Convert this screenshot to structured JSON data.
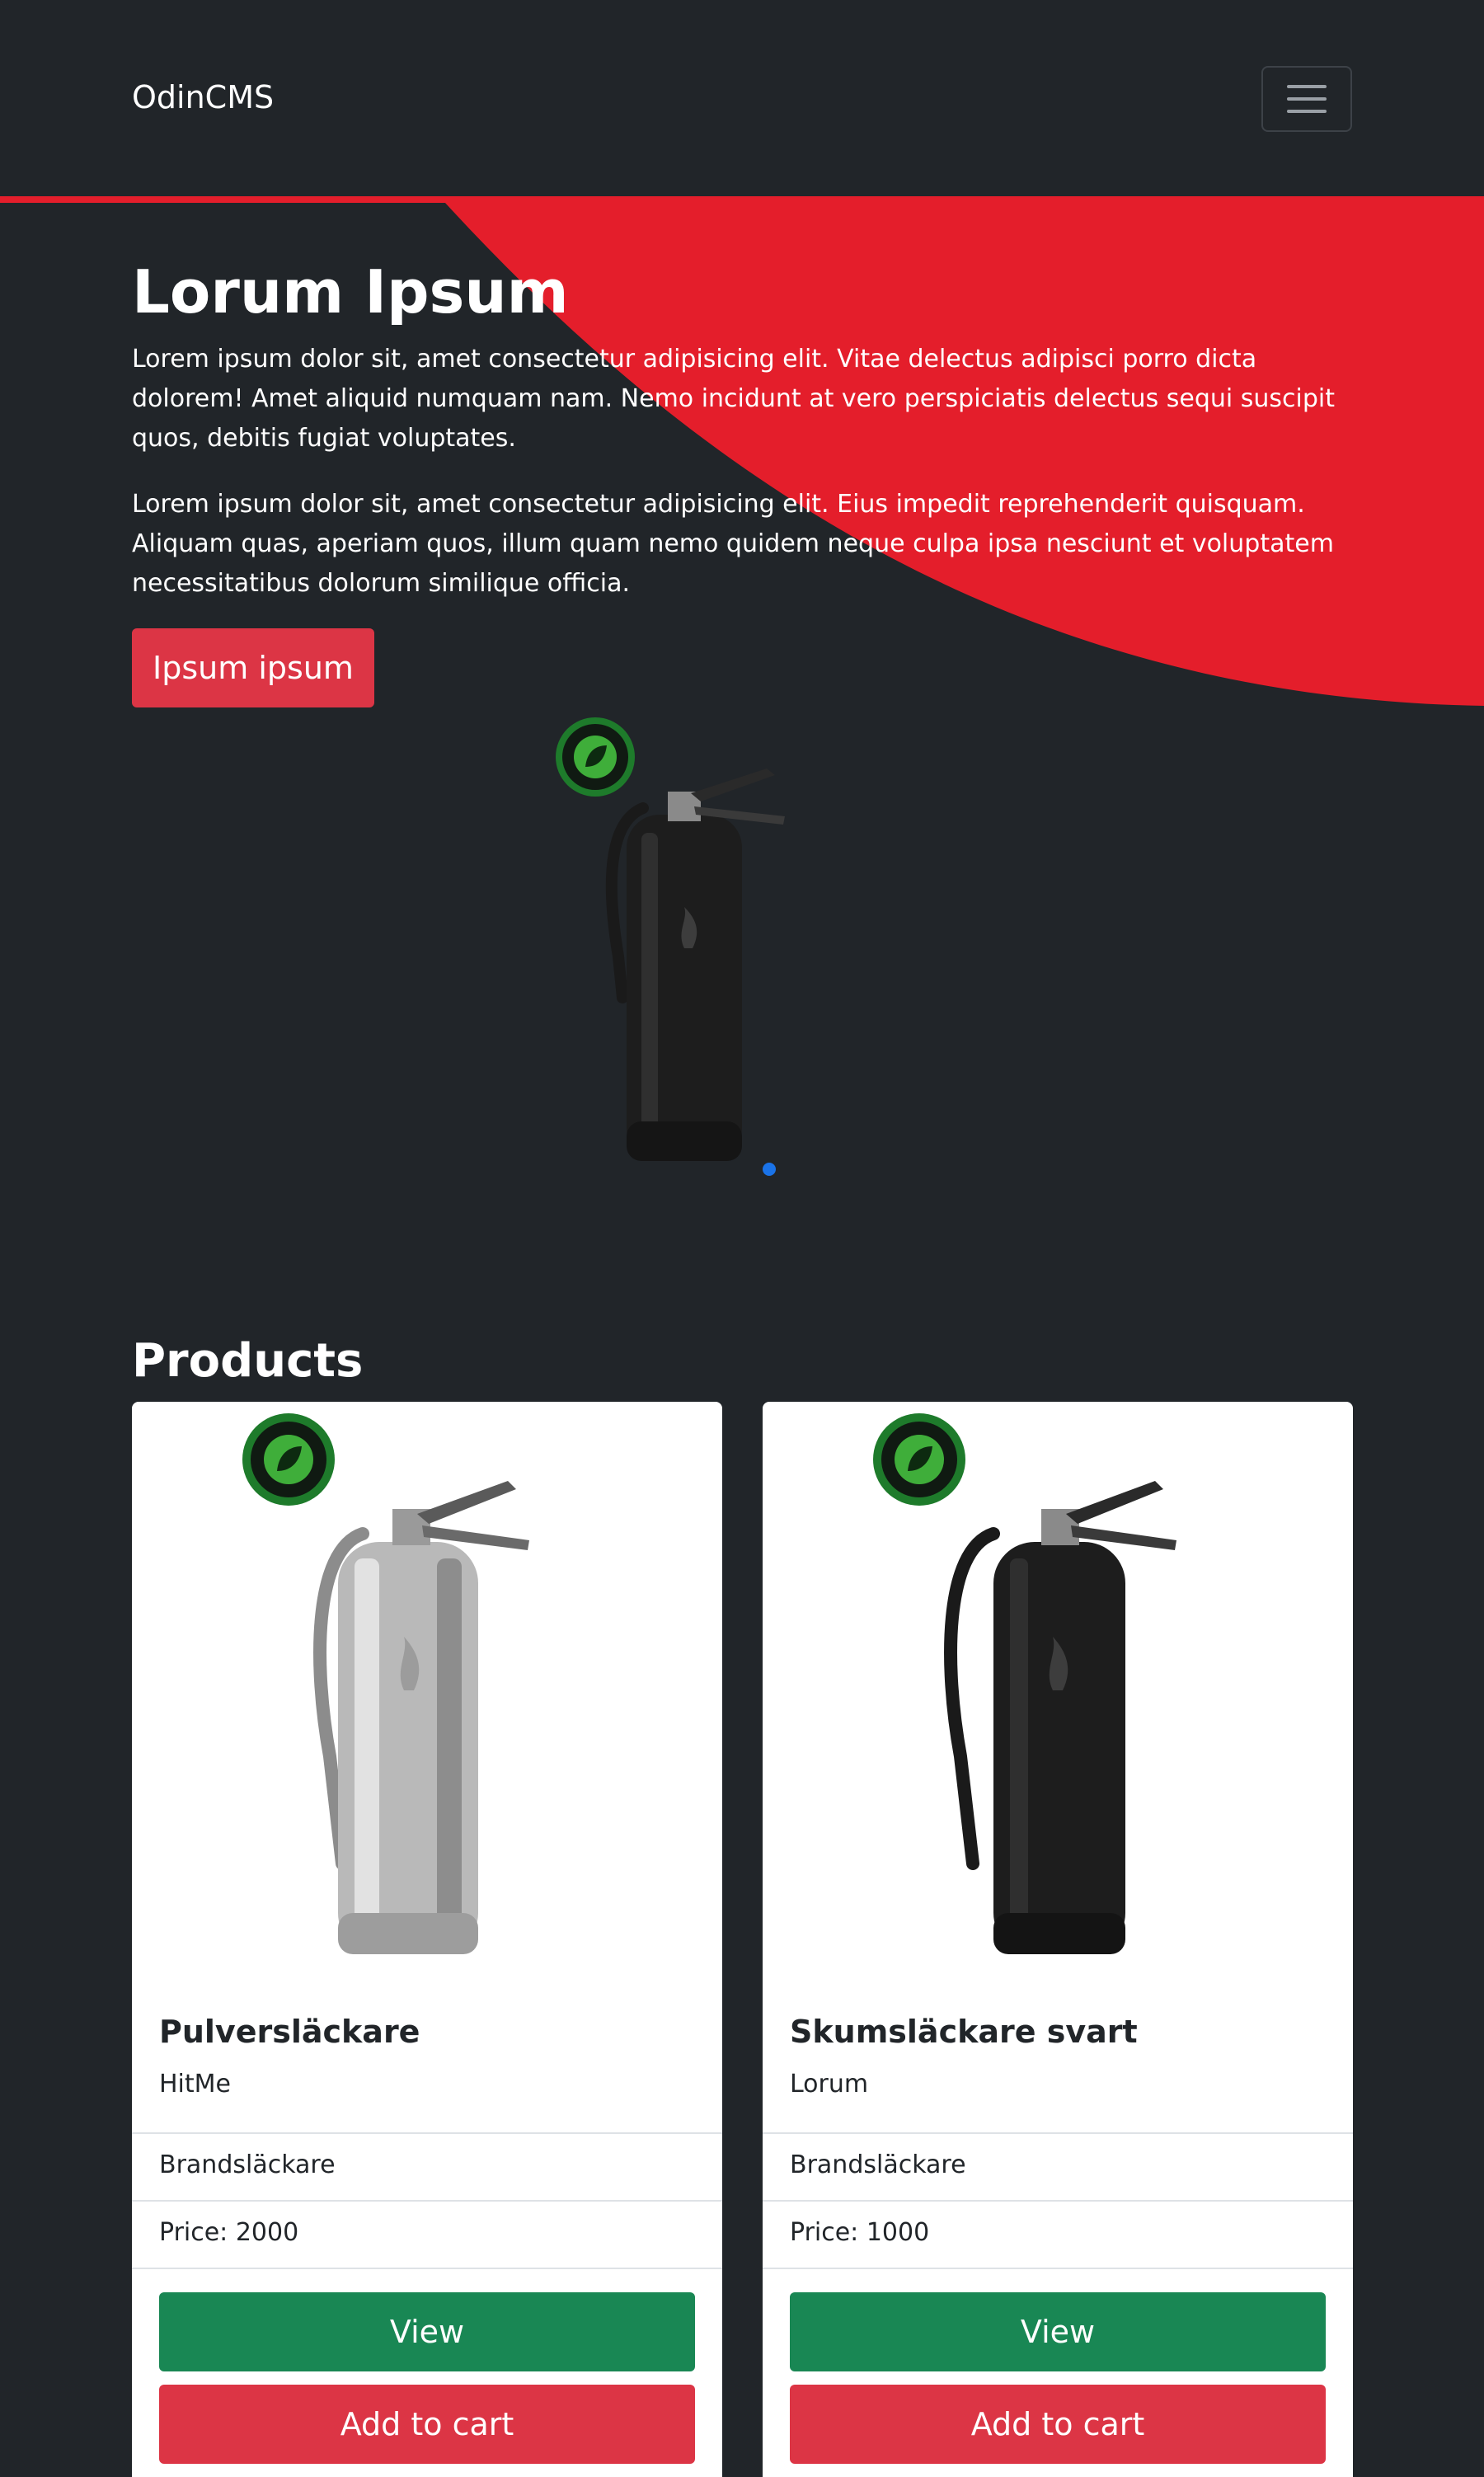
{
  "nav": {
    "brand": "OdinCMS",
    "toggler_icon": "hamburger-icon"
  },
  "hero": {
    "title": "Lorum Ipsum",
    "paragraph1": "Lorem ipsum dolor sit, amet consectetur adipisicing elit. Vitae delectus adipisci porro dicta dolorem! Amet aliquid numquam nam. Nemo incidunt at vero perspiciatis delectus sequi suscipit quos, debitis fugiat voluptates.",
    "paragraph2": "Lorem ipsum dolor sit, amet consectetur adipisicing elit. Eius impedit reprehenderit quisquam. Aliquam quas, aperiam quos, illum quam nemo quidem neque culpa ipsa nesciunt et voluptatem necessitatibus dolorum similique officia.",
    "button_label": "Ipsum ipsum",
    "accent_color": "#e41e2b"
  },
  "carousel": {
    "image": "black-fire-extinguisher-image",
    "badge": "environmental-badge-icon"
  },
  "products": {
    "title": "Products",
    "items": [
      {
        "name": "Pulversläckare",
        "brand": "HitMe",
        "category": "Brandsläckare",
        "price": "Price: 2000",
        "view_label": "View",
        "cart_label": "Add to cart",
        "image": "silver-fire-extinguisher-image"
      },
      {
        "name": "Skumsläckare svart",
        "brand": "Lorum",
        "category": "Brandsläckare",
        "price": "Price: 1000",
        "view_label": "View",
        "cart_label": "Add to cart",
        "image": "black-fire-extinguisher-image"
      }
    ]
  },
  "colors": {
    "background": "#212529",
    "danger": "#dc3545",
    "success": "#198754",
    "indicator": "#1a73e8"
  }
}
